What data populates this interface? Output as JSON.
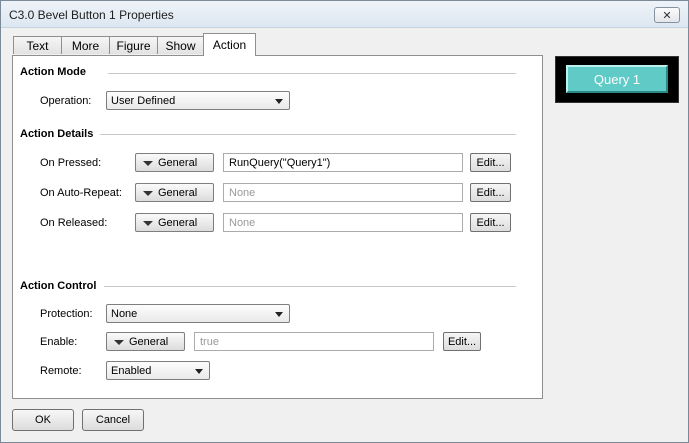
{
  "window": {
    "title": "C3.0 Bevel Button 1 Properties",
    "close_glyph": "✕"
  },
  "tabs": [
    {
      "label": "Text"
    },
    {
      "label": "More"
    },
    {
      "label": "Figure"
    },
    {
      "label": "Show"
    },
    {
      "label": "Action"
    }
  ],
  "active_tab": "Action",
  "action_mode": {
    "heading": "Action Mode",
    "operation_label": "Operation:",
    "operation_value": "User Defined"
  },
  "action_details": {
    "heading": "Action Details",
    "rows": [
      {
        "label": "On Pressed:",
        "menu": "General",
        "value": "RunQuery(\"Query1\")",
        "edit": "Edit..."
      },
      {
        "label": "On Auto-Repeat:",
        "menu": "General",
        "value": "None",
        "edit": "Edit..."
      },
      {
        "label": "On Released:",
        "menu": "General",
        "value": "None",
        "edit": "Edit..."
      }
    ]
  },
  "action_control": {
    "heading": "Action Control",
    "protection_label": "Protection:",
    "protection_value": "None",
    "enable_label": "Enable:",
    "enable_menu": "General",
    "enable_value": "true",
    "enable_edit": "Edit...",
    "remote_label": "Remote:",
    "remote_value": "Enabled"
  },
  "footer": {
    "ok": "OK",
    "cancel": "Cancel"
  },
  "preview": {
    "label": "Query 1",
    "bg_color": "#000000",
    "button_color": "#5fcac6"
  }
}
